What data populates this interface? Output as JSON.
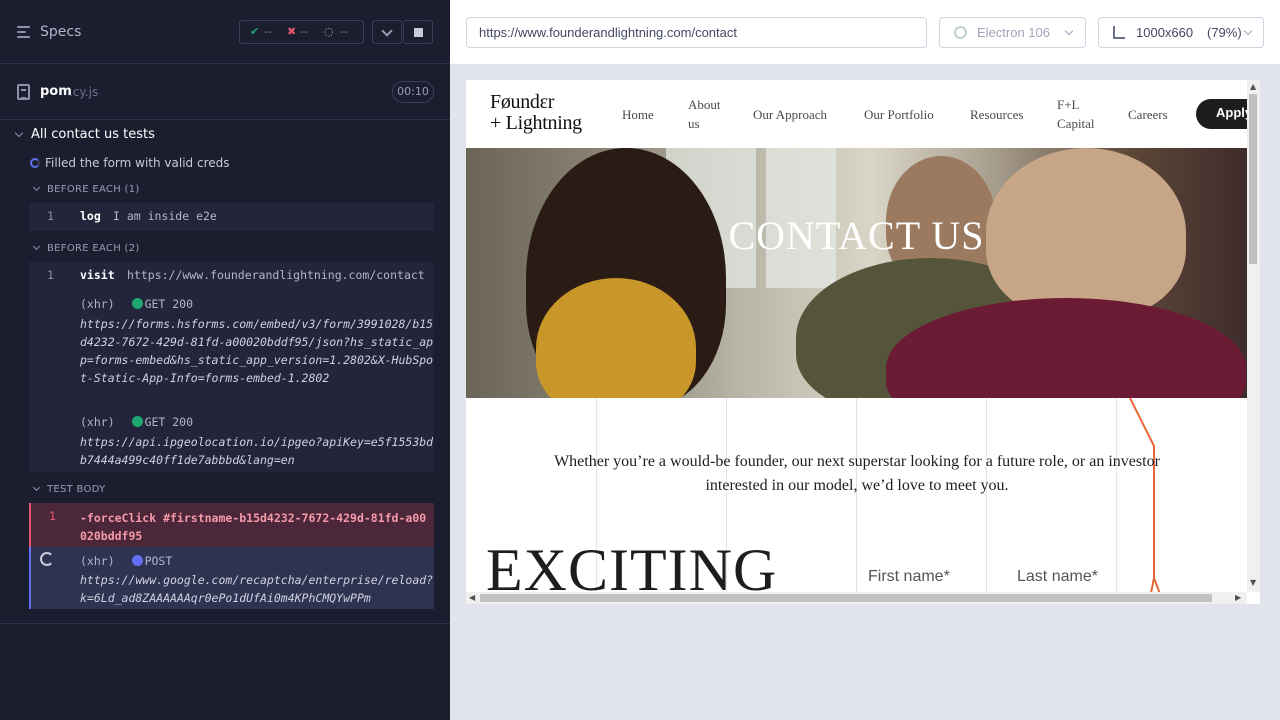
{
  "reporter": {
    "header": {
      "title": "Specs",
      "stats": {
        "passed": "--",
        "failed": "--",
        "pending": "--"
      }
    },
    "spec": {
      "name": "pom",
      "ext": ".cy.js",
      "duration": "00:10"
    },
    "suite": {
      "title": "All contact us tests"
    },
    "test": {
      "title": "Filled the form with valid creds"
    },
    "hooks": [
      {
        "title": "BEFORE EACH (1)",
        "commands": [
          {
            "num": "1",
            "name": "log",
            "message": "I am inside e2e"
          }
        ]
      },
      {
        "title": "BEFORE EACH (2)",
        "commands": [
          {
            "num": "1",
            "name": "visit",
            "message": "https://www.founderandlightning.com/contact"
          }
        ],
        "requests": [
          {
            "type": "(xhr)",
            "method": "GET 200",
            "url": "https://forms.hsforms.com/embed/v3/form/3991028/b15d4232-7672-429d-81fd-a00020bddf95/json?hs_static_app=forms-embed&hs_static_app_version=1.2802&X-HubSpot-Static-App-Info=forms-embed-1.2802"
          },
          {
            "type": "(xhr)",
            "method": "GET 200",
            "url": "https://api.ipgeolocation.io/ipgeo?apiKey=e5f1553bdb7444a499c40ff1de7abbbd&lang=en"
          }
        ]
      }
    ],
    "test_body": {
      "title": "TEST BODY",
      "failed_command": {
        "num": "1",
        "text": "-forceClick  #firstname-b15d4232-7672-429d-81fd-a00020bddf95"
      },
      "pending_request": {
        "type": "(xhr)",
        "method": "POST",
        "url": "https://www.google.com/recaptcha/enterprise/reload?k=6Ld_ad8ZAAAAAAqr0ePo1dUfAi0m4KPhCMQYwPPm"
      }
    }
  },
  "aut": {
    "url": "https://www.founderandlightning.com/contact",
    "browser": "Electron 106",
    "viewport_size": "1000x660",
    "viewport_scale": "(79%)",
    "site": {
      "logo_line1": "Føundεr",
      "logo_line2": "+ Lightning",
      "nav": [
        "Home",
        "About us",
        "Our Approach",
        "Our Portfolio",
        "Resources",
        "F+L Capital",
        "Careers"
      ],
      "nav_about_1": "About",
      "nav_about_2": "us",
      "nav_cap_1": "F+L",
      "nav_cap_2": "Capital",
      "apply": "Apply",
      "hero_title": "CONTACT US",
      "intro": "Whether you’re a would-be founder, our next superstar looking for a future role, or an investor interested in our model, we’d love to meet you.",
      "big_word": "EXCITING",
      "first_name_label": "First name*",
      "last_name_label": "Last name*"
    }
  },
  "colors": {
    "pass": "#1fa971",
    "fail": "#e45770",
    "pending": "#6470f3",
    "accent_orange": "#e8683a"
  }
}
